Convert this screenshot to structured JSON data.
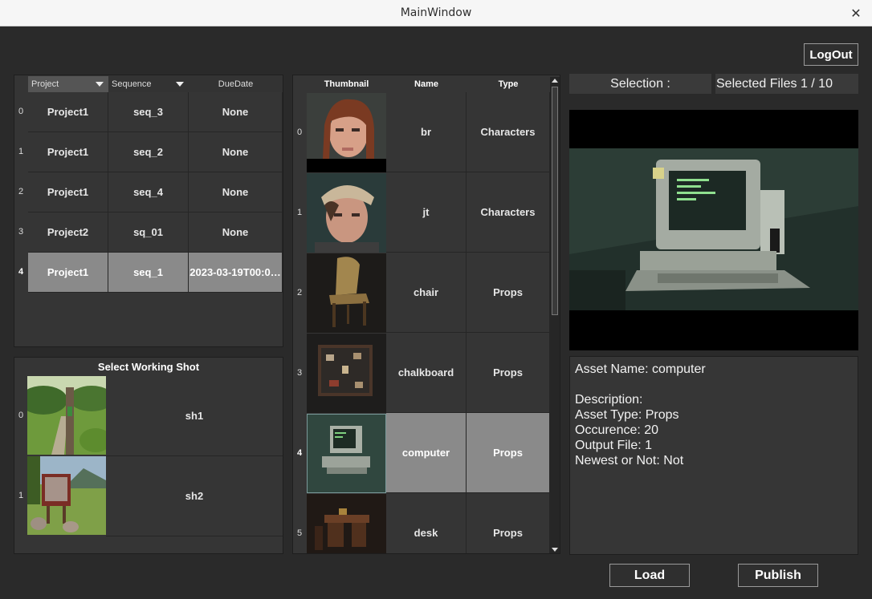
{
  "window": {
    "title": "MainWindow",
    "close_glyph": "✕"
  },
  "logout_label": "LogOut",
  "project_table": {
    "headers": [
      "Project",
      "Sequence",
      "DueDate"
    ],
    "rows": [
      {
        "index": "0",
        "project": "Project1",
        "sequence": "seq_3",
        "due": "None"
      },
      {
        "index": "1",
        "project": "Project1",
        "sequence": "seq_2",
        "due": "None"
      },
      {
        "index": "2",
        "project": "Project1",
        "sequence": "seq_4",
        "due": "None"
      },
      {
        "index": "3",
        "project": "Project2",
        "sequence": "sq_01",
        "due": "None"
      },
      {
        "index": "4",
        "project": "Project1",
        "sequence": "seq_1",
        "due": "2023-03-19T00:0…"
      }
    ],
    "selected_row": 4
  },
  "shots": {
    "title": "Select Working Shot",
    "rows": [
      {
        "index": "0",
        "name": "sh1"
      },
      {
        "index": "1",
        "name": "sh2"
      }
    ]
  },
  "asset_table": {
    "headers": [
      "Thumbnail",
      "Name",
      "Type"
    ],
    "rows": [
      {
        "index": "0",
        "name": "br",
        "type": "Characters"
      },
      {
        "index": "1",
        "name": "jt",
        "type": "Characters"
      },
      {
        "index": "2",
        "name": "chair",
        "type": "Props"
      },
      {
        "index": "3",
        "name": "chalkboard",
        "type": "Props"
      },
      {
        "index": "4",
        "name": "computer",
        "type": "Props"
      },
      {
        "index": "5",
        "name": "desk",
        "type": "Props"
      }
    ],
    "selected_row": 4
  },
  "selection_label": "Selection :",
  "selected_files": "Selected Files 1 / 10",
  "info": {
    "asset_name": "Asset Name: computer",
    "description": "Description:",
    "asset_type": "Asset Type: Props",
    "occurence": "Occurence: 20",
    "output_file": "Output File: 1",
    "newest": "Newest or Not: Not"
  },
  "buttons": {
    "load": "Load",
    "publish": "Publish"
  },
  "colors": {
    "background": "#2a2a2a",
    "selected_row": "#8a8a8a",
    "titlebar": "#f6f6f6"
  }
}
